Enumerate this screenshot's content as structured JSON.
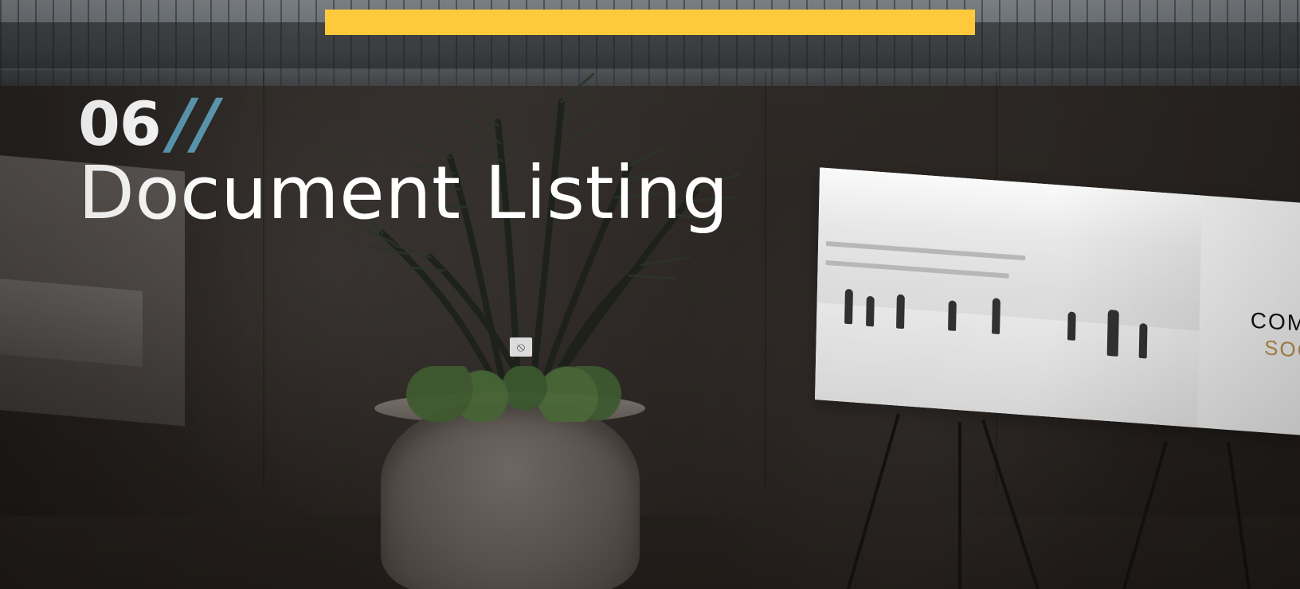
{
  "slide": {
    "section_number": "06",
    "section_separator": "//",
    "title": "Document Listing",
    "accent_color": "#ffc93c",
    "separator_color": "#5b97b0",
    "background_scene": {
      "poster_text_partial": "COMI",
      "poster_subtext_partial": "SOC",
      "small_sign_symbol": "⦸"
    }
  }
}
